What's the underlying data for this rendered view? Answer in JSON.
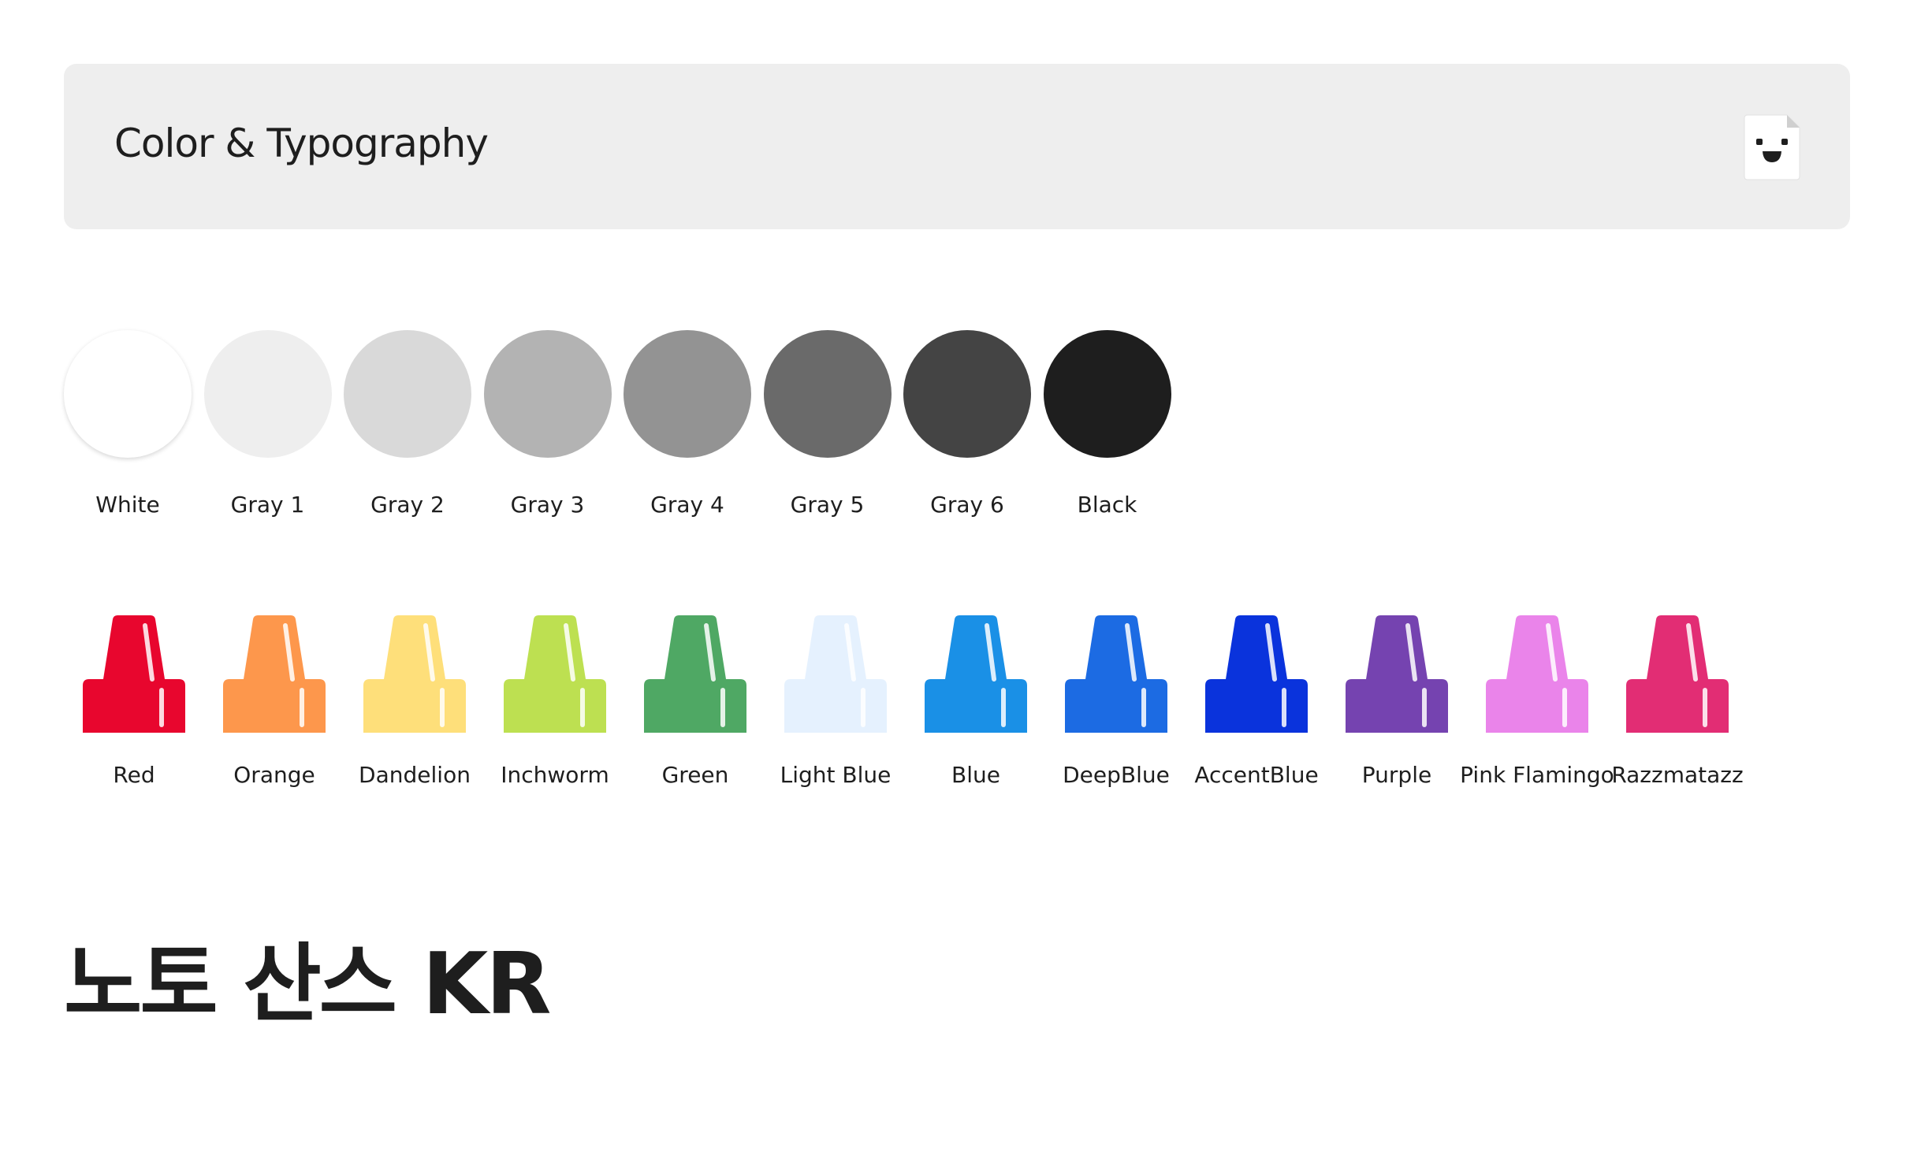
{
  "header": {
    "title": "Color & Typography",
    "icon": "smiling-document-icon"
  },
  "grayscale": [
    {
      "label": "White",
      "color": "#ffffff"
    },
    {
      "label": "Gray 1",
      "color": "#eeeeee"
    },
    {
      "label": "Gray 2",
      "color": "#d9d9d9"
    },
    {
      "label": "Gray 3",
      "color": "#b3b3b3"
    },
    {
      "label": "Gray 4",
      "color": "#939393"
    },
    {
      "label": "Gray 5",
      "color": "#6a6a6a"
    },
    {
      "label": "Gray 6",
      "color": "#444444"
    },
    {
      "label": "Black",
      "color": "#1e1e1e"
    }
  ],
  "crayons": [
    {
      "label": "Red",
      "color": "#e8062e"
    },
    {
      "label": "Orange",
      "color": "#fd974c"
    },
    {
      "label": "Dandelion",
      "color": "#fedf7a"
    },
    {
      "label": "Inchworm",
      "color": "#bde051"
    },
    {
      "label": "Green",
      "color": "#4fa864"
    },
    {
      "label": "Light Blue",
      "color": "#e5f1fe"
    },
    {
      "label": "Blue",
      "color": "#1a90e6"
    },
    {
      "label": "DeepBlue",
      "color": "#1c6be3"
    },
    {
      "label": "AccentBlue",
      "color": "#0a33dc"
    },
    {
      "label": "Purple",
      "color": "#7543b0"
    },
    {
      "label": "Pink Flamingo",
      "color": "#ea84ea"
    },
    {
      "label": "Razzmatazz",
      "color": "#e22d74"
    }
  ],
  "typography": {
    "font_name": "노토 산스 KR"
  }
}
